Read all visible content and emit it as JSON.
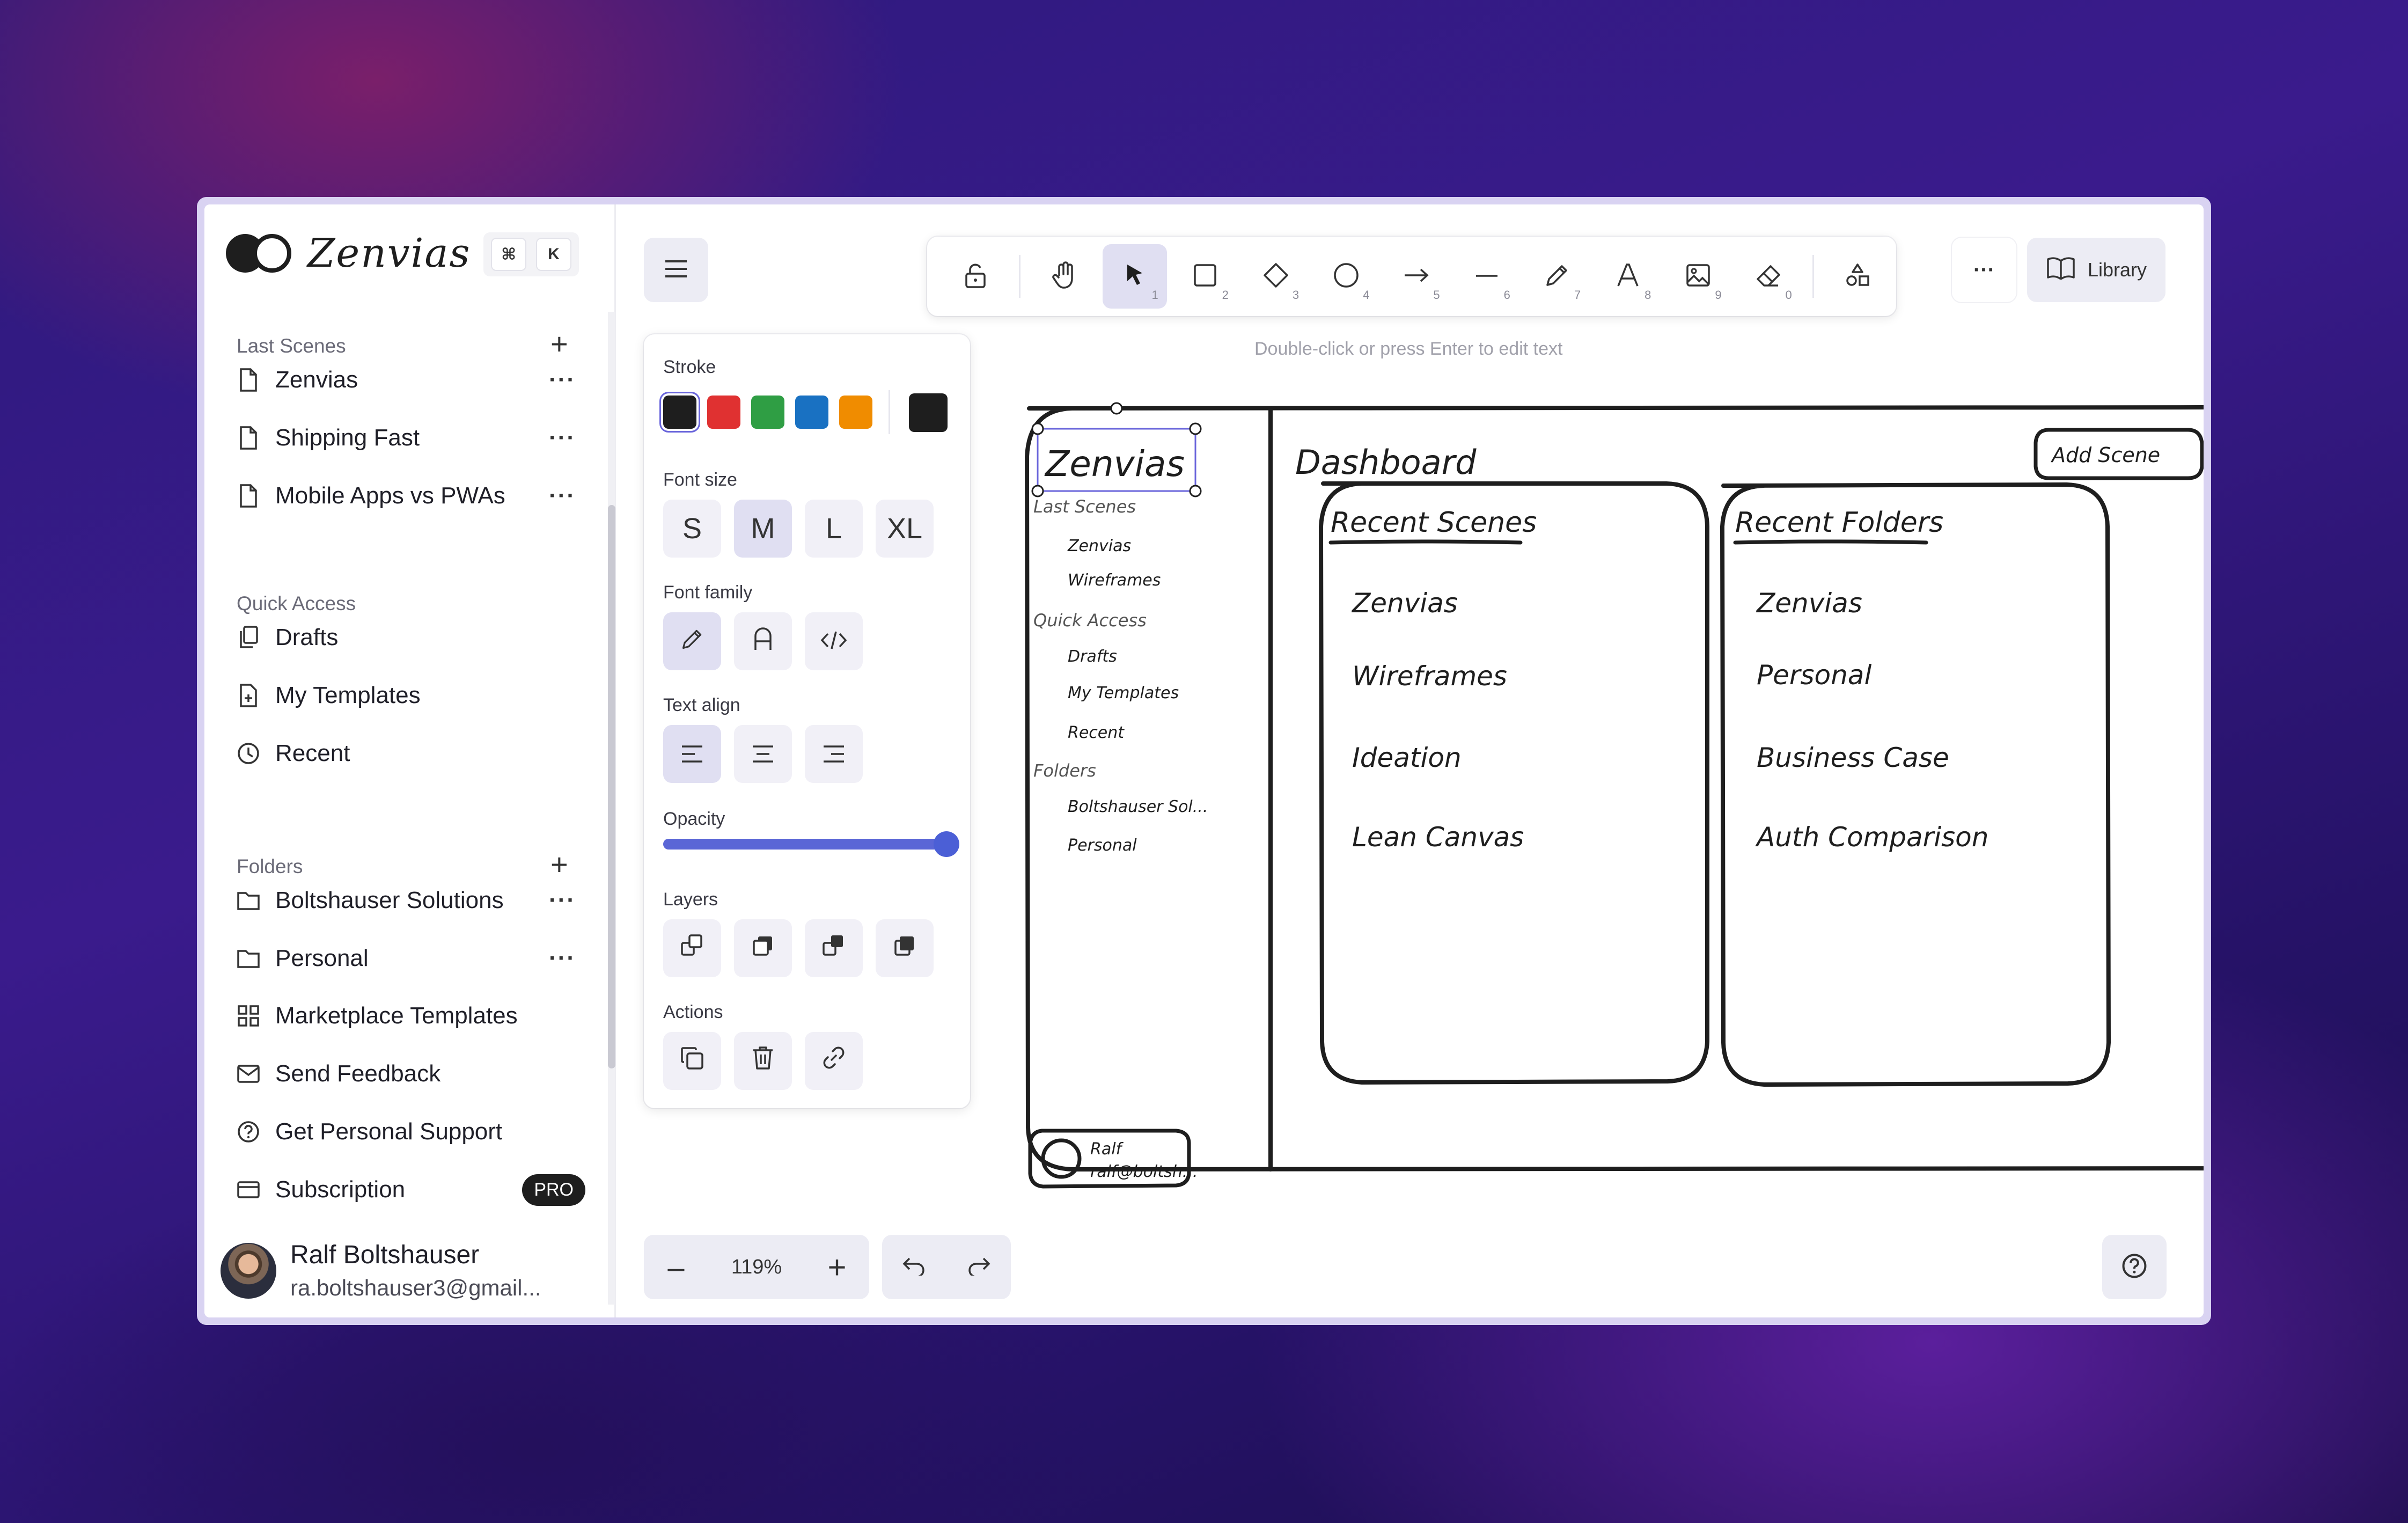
{
  "sidebar": {
    "logo_text": "Zenvias",
    "shortcut": [
      "⌘",
      "K"
    ],
    "last_scenes_title": "Last Scenes",
    "last_scenes": [
      {
        "label": "Zenvias"
      },
      {
        "label": "Shipping Fast"
      },
      {
        "label": "Mobile Apps vs PWAs"
      }
    ],
    "quick_access_title": "Quick Access",
    "quick_access": [
      {
        "label": "Drafts"
      },
      {
        "label": "My Templates"
      },
      {
        "label": "Recent"
      }
    ],
    "folders_title": "Folders",
    "folders": [
      {
        "label": "Boltshauser Solutions"
      },
      {
        "label": "Personal"
      }
    ],
    "links": [
      {
        "label": "Marketplace Templates"
      },
      {
        "label": "Send Feedback"
      },
      {
        "label": "Get Personal Support"
      },
      {
        "label": "Subscription",
        "badge": "PRO"
      }
    ],
    "user": {
      "name": "Ralf Boltshauser",
      "email": "ra.boltshauser3@gmail..."
    }
  },
  "toolbar": {
    "tools": [
      {
        "name": "lock-icon",
        "num": ""
      },
      {
        "name": "hand-icon",
        "num": ""
      },
      {
        "name": "pointer-icon",
        "num": "1"
      },
      {
        "name": "rectangle-icon",
        "num": "2"
      },
      {
        "name": "diamond-icon",
        "num": "3"
      },
      {
        "name": "ellipse-icon",
        "num": "4"
      },
      {
        "name": "arrow-icon",
        "num": "5"
      },
      {
        "name": "line-icon",
        "num": "6"
      },
      {
        "name": "pencil-icon",
        "num": "7"
      },
      {
        "name": "text-icon",
        "num": "8"
      },
      {
        "name": "image-icon",
        "num": "9"
      },
      {
        "name": "eraser-icon",
        "num": "0"
      },
      {
        "name": "shapes-icon",
        "num": ""
      }
    ],
    "hint": "Double-click or press Enter to edit text",
    "library_label": "Library"
  },
  "props": {
    "stroke_label": "Stroke",
    "stroke_colors": [
      "#1e1e1e",
      "#e03131",
      "#2f9e44",
      "#1971c2",
      "#f08c00"
    ],
    "current_color": "#1e1e1e",
    "font_size_label": "Font size",
    "font_sizes": [
      "S",
      "M",
      "L",
      "XL"
    ],
    "font_size_selected": "M",
    "font_family_label": "Font family",
    "text_align_label": "Text align",
    "opacity_label": "Opacity",
    "opacity_value": 100,
    "layers_label": "Layers",
    "actions_label": "Actions"
  },
  "zoom": {
    "value": "119%"
  },
  "sketch": {
    "logo": "Zenvias",
    "last_scenes_title": "Last Scenes",
    "last_scenes": [
      "Zenvias",
      "Wireframes"
    ],
    "quick_access_title": "Quick Access",
    "quick_access": [
      "Drafts",
      "My Templates",
      "Recent"
    ],
    "folders_title": "Folders",
    "folders": [
      "Boltshauser Sol...",
      "Personal"
    ],
    "user_name": "Ralf",
    "user_email": "ralf@boltsh...",
    "dashboard_title": "Dashboard",
    "add_scene": "Add Scene",
    "recent_scenes_title": "Recent Scenes",
    "recent_scenes": [
      "Zenvias",
      "Wireframes",
      "Ideation",
      "Lean Canvas"
    ],
    "recent_folders_title": "Recent Folders",
    "recent_folders": [
      "Zenvias",
      "Personal",
      "Business Case",
      "Auth Comparison"
    ]
  }
}
